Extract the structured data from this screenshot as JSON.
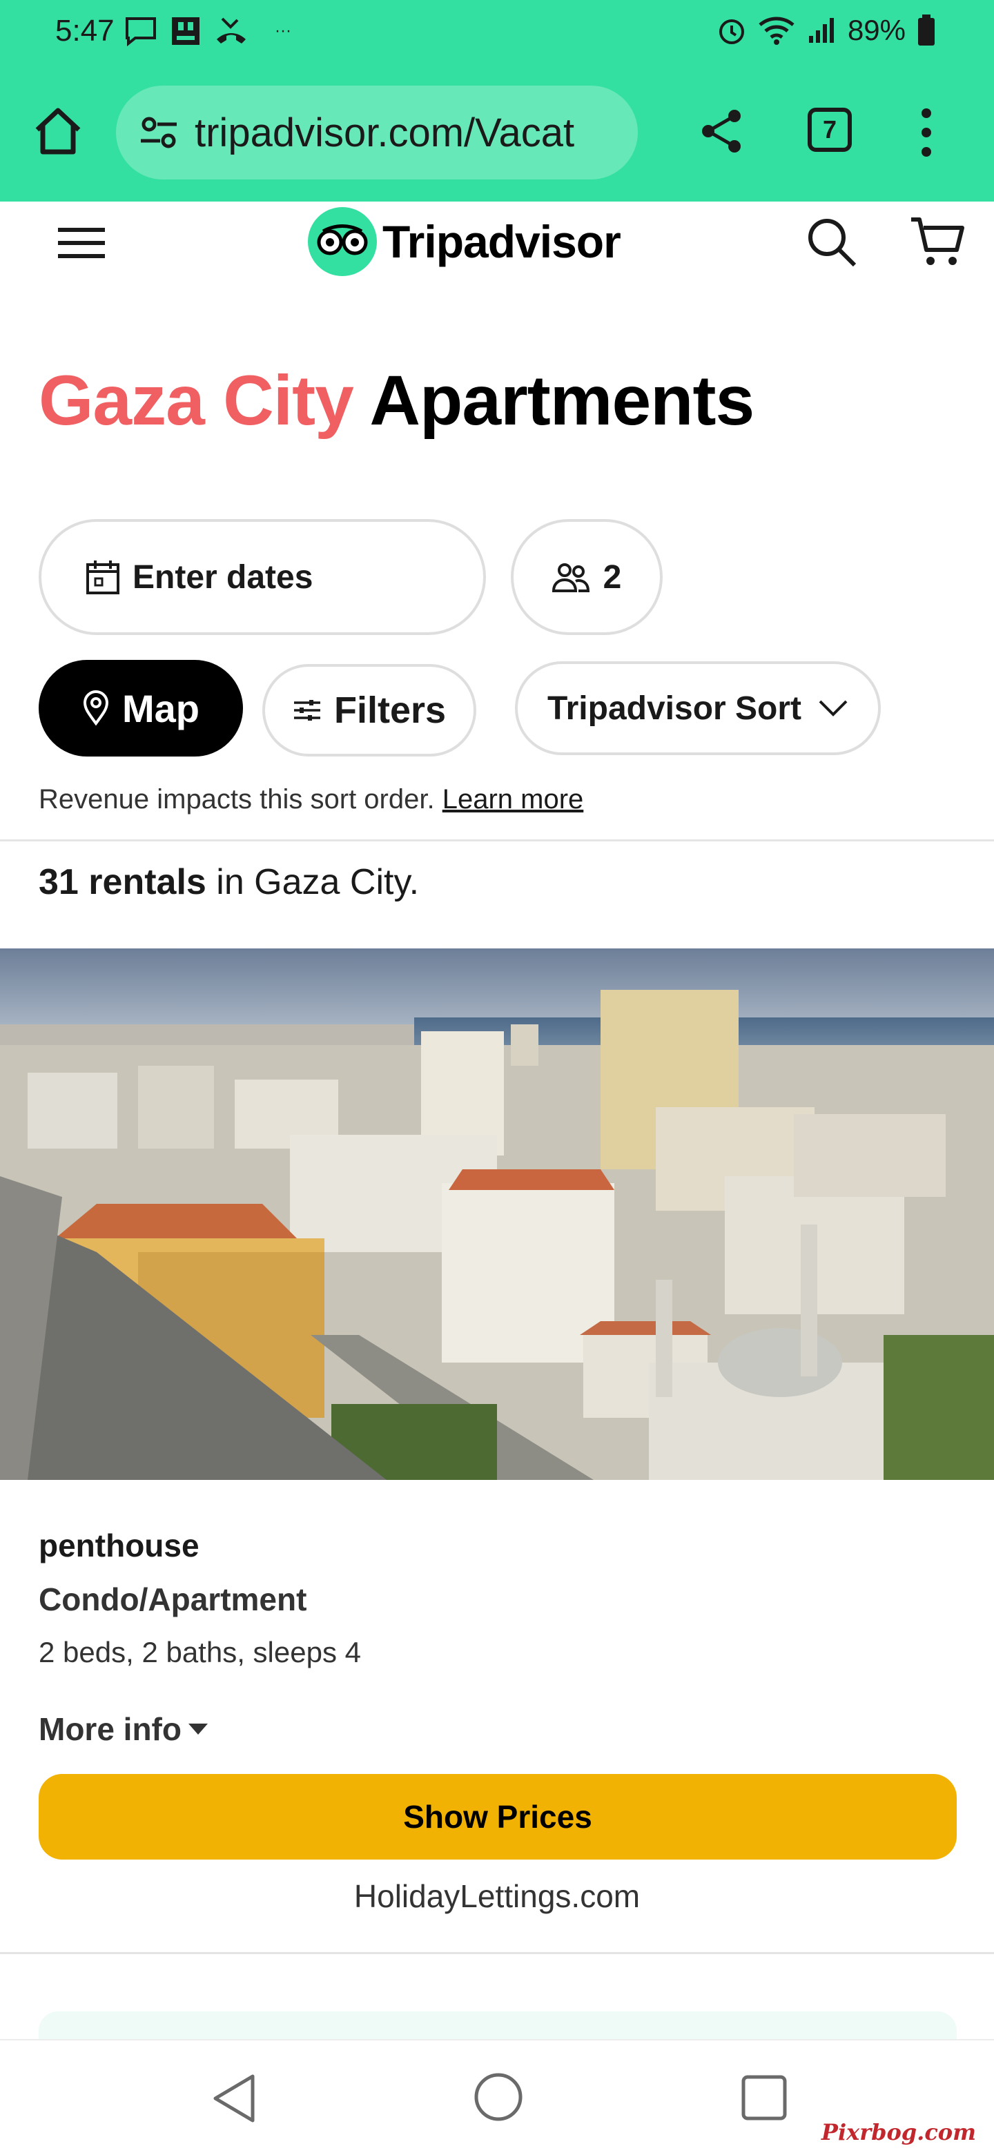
{
  "status_bar": {
    "time": "5:47",
    "battery": "89%",
    "icons": [
      "message-icon",
      "sim-icon",
      "missed-call-icon",
      "more-dots-icon",
      "alarm-icon",
      "wifi-icon",
      "signal-icon",
      "battery-icon"
    ]
  },
  "browser": {
    "url": "tripadvisor.com/Vacat",
    "tab_count": "7",
    "theme_color": "#34e0a1"
  },
  "site_header": {
    "logo_text": "Tripadvisor"
  },
  "page": {
    "title_city": "Gaza City",
    "title_rest": "Apartments",
    "dates_label": "Enter dates",
    "guests_count": "2",
    "map_label": "Map",
    "filters_label": "Filters",
    "sort_label": "Tripadvisor Sort",
    "revenue_note": "Revenue impacts this sort order.",
    "learn_more": "Learn more",
    "rentals_count": "31 rentals",
    "rentals_suffix": "in Gaza City."
  },
  "listing": {
    "name": "penthouse",
    "type": "Condo/Apartment",
    "specs": "2 beds, 2 baths, sleeps 4",
    "more_info": "More info",
    "show_prices": "Show Prices",
    "provider": "HolidayLettings.com"
  },
  "watermark": "Pixrbog.com",
  "colors": {
    "accent_green": "#34e0a1",
    "title_red": "#f05f62",
    "cta_yellow": "#f2b203"
  }
}
